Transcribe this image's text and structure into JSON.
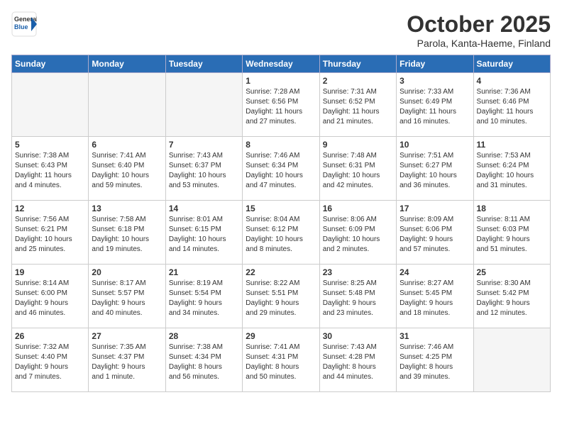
{
  "header": {
    "logo_general": "General",
    "logo_blue": "Blue",
    "title": "October 2025",
    "subtitle": "Parola, Kanta-Haeme, Finland"
  },
  "weekdays": [
    "Sunday",
    "Monday",
    "Tuesday",
    "Wednesday",
    "Thursday",
    "Friday",
    "Saturday"
  ],
  "weeks": [
    [
      {
        "day": "",
        "info": ""
      },
      {
        "day": "",
        "info": ""
      },
      {
        "day": "",
        "info": ""
      },
      {
        "day": "1",
        "info": "Sunrise: 7:28 AM\nSunset: 6:56 PM\nDaylight: 11 hours\nand 27 minutes."
      },
      {
        "day": "2",
        "info": "Sunrise: 7:31 AM\nSunset: 6:52 PM\nDaylight: 11 hours\nand 21 minutes."
      },
      {
        "day": "3",
        "info": "Sunrise: 7:33 AM\nSunset: 6:49 PM\nDaylight: 11 hours\nand 16 minutes."
      },
      {
        "day": "4",
        "info": "Sunrise: 7:36 AM\nSunset: 6:46 PM\nDaylight: 11 hours\nand 10 minutes."
      }
    ],
    [
      {
        "day": "5",
        "info": "Sunrise: 7:38 AM\nSunset: 6:43 PM\nDaylight: 11 hours\nand 4 minutes."
      },
      {
        "day": "6",
        "info": "Sunrise: 7:41 AM\nSunset: 6:40 PM\nDaylight: 10 hours\nand 59 minutes."
      },
      {
        "day": "7",
        "info": "Sunrise: 7:43 AM\nSunset: 6:37 PM\nDaylight: 10 hours\nand 53 minutes."
      },
      {
        "day": "8",
        "info": "Sunrise: 7:46 AM\nSunset: 6:34 PM\nDaylight: 10 hours\nand 47 minutes."
      },
      {
        "day": "9",
        "info": "Sunrise: 7:48 AM\nSunset: 6:31 PM\nDaylight: 10 hours\nand 42 minutes."
      },
      {
        "day": "10",
        "info": "Sunrise: 7:51 AM\nSunset: 6:27 PM\nDaylight: 10 hours\nand 36 minutes."
      },
      {
        "day": "11",
        "info": "Sunrise: 7:53 AM\nSunset: 6:24 PM\nDaylight: 10 hours\nand 31 minutes."
      }
    ],
    [
      {
        "day": "12",
        "info": "Sunrise: 7:56 AM\nSunset: 6:21 PM\nDaylight: 10 hours\nand 25 minutes."
      },
      {
        "day": "13",
        "info": "Sunrise: 7:58 AM\nSunset: 6:18 PM\nDaylight: 10 hours\nand 19 minutes."
      },
      {
        "day": "14",
        "info": "Sunrise: 8:01 AM\nSunset: 6:15 PM\nDaylight: 10 hours\nand 14 minutes."
      },
      {
        "day": "15",
        "info": "Sunrise: 8:04 AM\nSunset: 6:12 PM\nDaylight: 10 hours\nand 8 minutes."
      },
      {
        "day": "16",
        "info": "Sunrise: 8:06 AM\nSunset: 6:09 PM\nDaylight: 10 hours\nand 2 minutes."
      },
      {
        "day": "17",
        "info": "Sunrise: 8:09 AM\nSunset: 6:06 PM\nDaylight: 9 hours\nand 57 minutes."
      },
      {
        "day": "18",
        "info": "Sunrise: 8:11 AM\nSunset: 6:03 PM\nDaylight: 9 hours\nand 51 minutes."
      }
    ],
    [
      {
        "day": "19",
        "info": "Sunrise: 8:14 AM\nSunset: 6:00 PM\nDaylight: 9 hours\nand 46 minutes."
      },
      {
        "day": "20",
        "info": "Sunrise: 8:17 AM\nSunset: 5:57 PM\nDaylight: 9 hours\nand 40 minutes."
      },
      {
        "day": "21",
        "info": "Sunrise: 8:19 AM\nSunset: 5:54 PM\nDaylight: 9 hours\nand 34 minutes."
      },
      {
        "day": "22",
        "info": "Sunrise: 8:22 AM\nSunset: 5:51 PM\nDaylight: 9 hours\nand 29 minutes."
      },
      {
        "day": "23",
        "info": "Sunrise: 8:25 AM\nSunset: 5:48 PM\nDaylight: 9 hours\nand 23 minutes."
      },
      {
        "day": "24",
        "info": "Sunrise: 8:27 AM\nSunset: 5:45 PM\nDaylight: 9 hours\nand 18 minutes."
      },
      {
        "day": "25",
        "info": "Sunrise: 8:30 AM\nSunset: 5:42 PM\nDaylight: 9 hours\nand 12 minutes."
      }
    ],
    [
      {
        "day": "26",
        "info": "Sunrise: 7:32 AM\nSunset: 4:40 PM\nDaylight: 9 hours\nand 7 minutes."
      },
      {
        "day": "27",
        "info": "Sunrise: 7:35 AM\nSunset: 4:37 PM\nDaylight: 9 hours\nand 1 minute."
      },
      {
        "day": "28",
        "info": "Sunrise: 7:38 AM\nSunset: 4:34 PM\nDaylight: 8 hours\nand 56 minutes."
      },
      {
        "day": "29",
        "info": "Sunrise: 7:41 AM\nSunset: 4:31 PM\nDaylight: 8 hours\nand 50 minutes."
      },
      {
        "day": "30",
        "info": "Sunrise: 7:43 AM\nSunset: 4:28 PM\nDaylight: 8 hours\nand 44 minutes."
      },
      {
        "day": "31",
        "info": "Sunrise: 7:46 AM\nSunset: 4:25 PM\nDaylight: 8 hours\nand 39 minutes."
      },
      {
        "day": "",
        "info": ""
      }
    ]
  ]
}
